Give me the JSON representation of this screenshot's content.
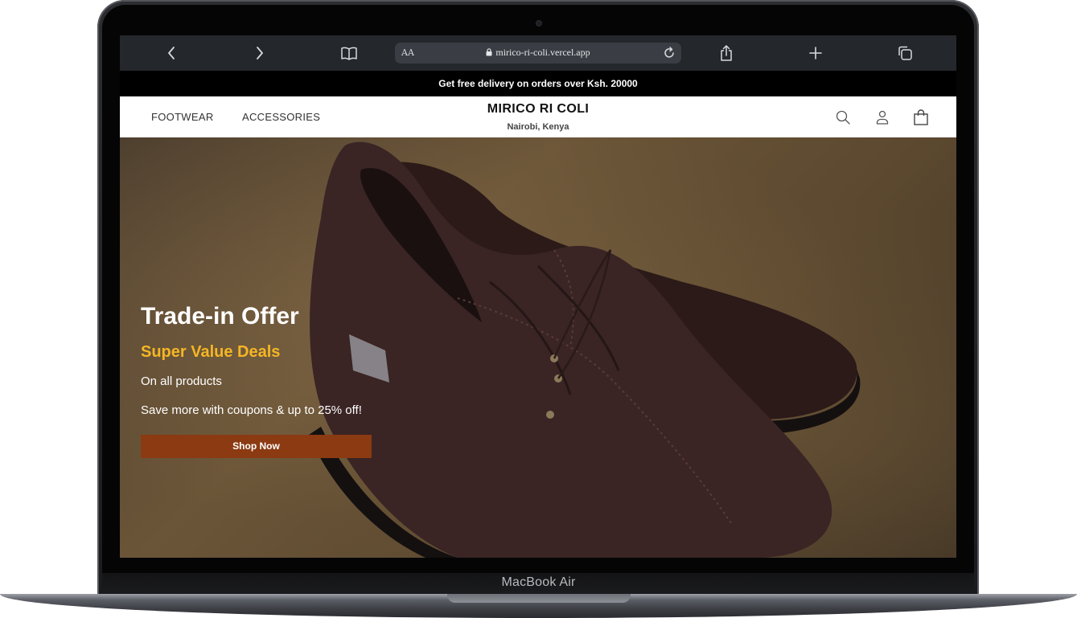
{
  "device": {
    "label": "MacBook Air"
  },
  "browser": {
    "reader_label": "AA",
    "url": "mirico-ri-coli.vercel.app",
    "icons": [
      "back-icon",
      "forward-icon",
      "book-icon",
      "lock-icon",
      "reload-icon",
      "share-icon",
      "plus-icon",
      "tabs-icon"
    ]
  },
  "announcement": "Get free delivery on orders over Ksh. 20000",
  "nav": {
    "links": [
      "FOOTWEAR",
      "ACCESSORIES"
    ],
    "brand": "MIRICO RI COLI",
    "location": "Nairobi, Kenya",
    "icons": [
      "search-icon",
      "account-icon",
      "bag-icon"
    ]
  },
  "hero": {
    "title": "Trade-in Offer",
    "subtitle": "Super Value Deals",
    "line1": "On all products",
    "line2": "Save more with coupons & up to 25% off!",
    "button": "Shop Now",
    "colors": {
      "subtitle": "#f5b624",
      "button": "#8b3a12"
    }
  }
}
